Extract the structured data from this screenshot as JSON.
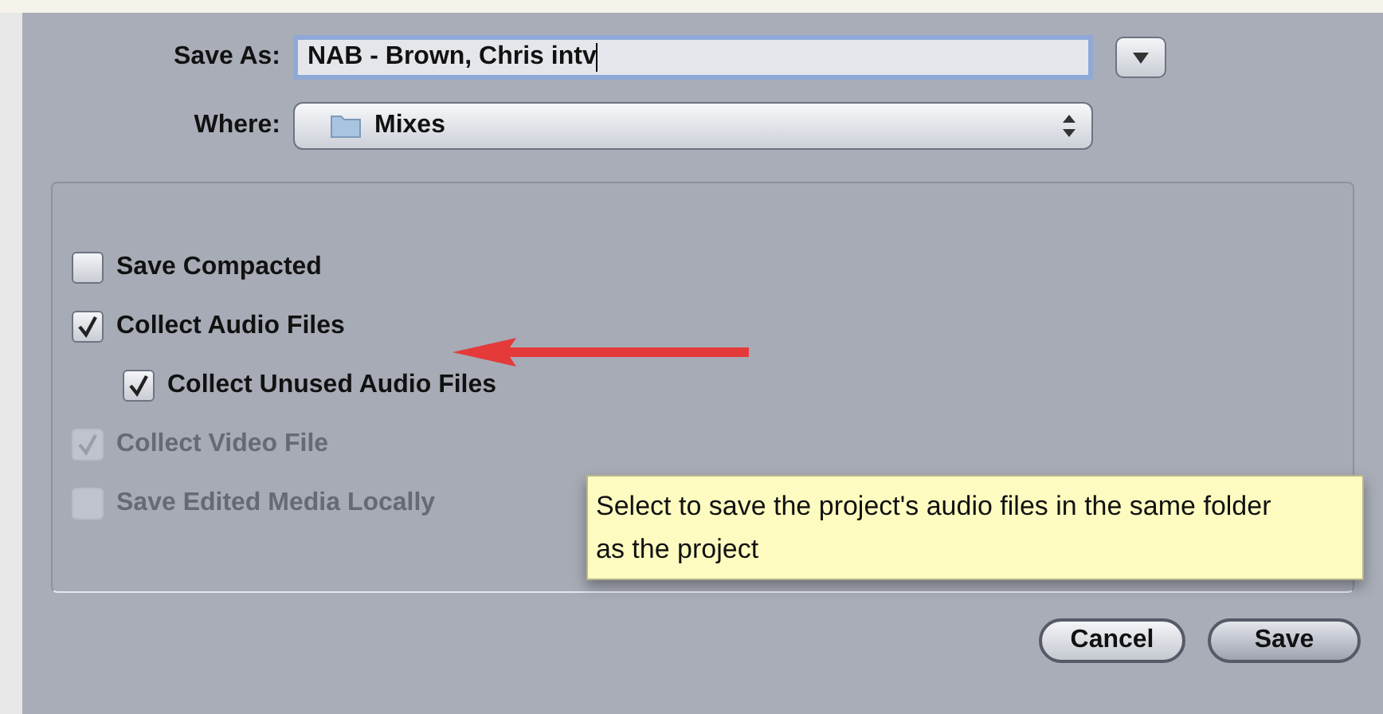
{
  "save_as": {
    "label": "Save As:",
    "value": "NAB - Brown, Chris intv"
  },
  "where": {
    "label": "Where:",
    "value": "Mixes"
  },
  "options": [
    {
      "label": "Save Compacted",
      "checked": false,
      "disabled": false
    },
    {
      "label": "Collect Audio Files",
      "checked": true,
      "disabled": false,
      "children": [
        {
          "label": "Collect Unused Audio Files",
          "checked": true,
          "disabled": false
        }
      ]
    },
    {
      "label": "Collect Video File",
      "checked": true,
      "disabled": true
    },
    {
      "label": "Save Edited Media Locally",
      "checked": false,
      "disabled": true
    }
  ],
  "tooltip": "Select to save the project's audio files in the same folder as the project",
  "buttons": [
    {
      "label": "Cancel",
      "kind": "cancel"
    },
    {
      "label": "Save",
      "kind": "default"
    }
  ]
}
